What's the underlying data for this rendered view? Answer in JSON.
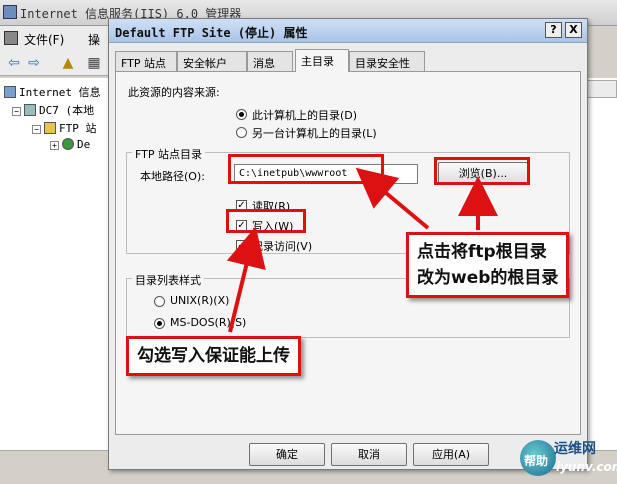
{
  "background_window": {
    "title": "Internet 信息服务(IIS) 6.0 管理器",
    "menu": {
      "file": "文件(F)",
      "action": "操"
    },
    "tree": [
      {
        "label": "Internet 信息"
      },
      {
        "label": "DC7 (本地"
      },
      {
        "label": "FTP 站"
      },
      {
        "label": "De"
      }
    ],
    "right_header": "状"
  },
  "dialog": {
    "title": "Default FTP Site (停止) 属性",
    "title_buttons": {
      "help": "?",
      "close": "X"
    },
    "tabs": [
      {
        "label": "FTP 站点",
        "active": false
      },
      {
        "label": "安全帐户",
        "active": false
      },
      {
        "label": "消息",
        "active": false
      },
      {
        "label": "主目录",
        "active": true
      },
      {
        "label": "目录安全性",
        "active": false
      }
    ],
    "content_source_label": "此资源的内容来源:",
    "source_options": [
      {
        "label": "此计算机上的目录(D)",
        "checked": true
      },
      {
        "label": "另一台计算机上的目录(L)",
        "checked": false
      }
    ],
    "ftp_dir_group": {
      "title": "FTP 站点目录",
      "local_path_label": "本地路径(O):",
      "local_path_value": "C:\\inetpub\\wwwroot",
      "browse_label": "浏览(B)...",
      "permissions": [
        {
          "label": "读取(R)",
          "checked": true
        },
        {
          "label": "写入(W)",
          "checked": true
        },
        {
          "label": "记录访问(V)",
          "checked": true
        }
      ]
    },
    "listing_group": {
      "title": "目录列表样式",
      "options": [
        {
          "label": "UNIX(R)(X)",
          "checked": false
        },
        {
          "label": "MS-DOS(R)(S)",
          "checked": true
        }
      ]
    },
    "buttons": {
      "ok": "确定",
      "cancel": "取消",
      "apply": "应用(A)",
      "help": "帮助"
    }
  },
  "annotations": {
    "browse_callout": [
      "点击将ftp根目录",
      "改为web的根目录"
    ],
    "write_callout": "勾选写入保证能上传",
    "color": "#dd1111"
  },
  "watermark": {
    "name": "运维网",
    "help": "帮助",
    "url": "iyunv.com"
  }
}
